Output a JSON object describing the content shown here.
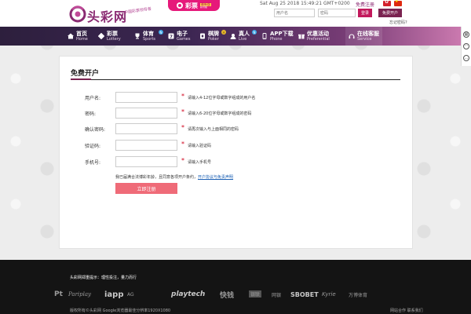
{
  "header": {
    "logo_text": "头彩网",
    "logo_slogan": "中国彩票领导者",
    "promo": {
      "main": "彩票",
      "badge": "最新版",
      "sub": "彩讯版"
    },
    "datetime": "Sat Aug 25 2018 15:49:21 GMT+0200",
    "register_link": "免费注册",
    "username_placeholder": "用户名",
    "password_placeholder": "密码",
    "login_label": "登录",
    "register_label": "免费开户",
    "forgot_label": "忘记密码?"
  },
  "nav": [
    {
      "cn": "首页",
      "en": "Home",
      "icon": "home-icon",
      "badge": ""
    },
    {
      "cn": "彩票",
      "en": "Lottery",
      "icon": "lottery-icon",
      "badge": ""
    },
    {
      "cn": "体育",
      "en": "Sports",
      "icon": "trophy-icon",
      "badge": "N"
    },
    {
      "cn": "电子",
      "en": "Games",
      "icon": "slot-icon",
      "badge": ""
    },
    {
      "cn": "棋牌",
      "en": "Poker",
      "icon": "poker-icon",
      "badge": "H"
    },
    {
      "cn": "真人",
      "en": "Live",
      "icon": "live-icon",
      "badge": "N"
    },
    {
      "cn": "APP下载",
      "en": "Phone",
      "icon": "phone-icon",
      "badge": ""
    },
    {
      "cn": "优惠活动",
      "en": "Preferential",
      "icon": "gift-icon",
      "badge": ""
    },
    {
      "cn": "在线客服",
      "en": "Service",
      "icon": "service-icon",
      "badge": ""
    }
  ],
  "rail": {
    "icons": [
      "qr-code-icon",
      "headset-icon",
      "chat-icon"
    ]
  },
  "panel": {
    "title": "免费开户",
    "fields": [
      {
        "label": "用户名:",
        "hint": "请输入4-12位字母或数字组成的用户名"
      },
      {
        "label": "密码:",
        "hint": "请输入6-20位字母或数字组成的密码"
      },
      {
        "label": "确认密码:",
        "hint": "请再次输入与上面相同的密码"
      },
      {
        "label": "验证码:",
        "hint": "请输入验证码"
      },
      {
        "label": "手机号:",
        "hint": "请输入手机号"
      }
    ],
    "agree_text": "我已届满合法博彩年龄，且同意各项开户条约，",
    "agree_link": "开户协议与免责声明",
    "submit_label": "立即注册"
  },
  "footer": {
    "notice": "头彩网郑重提示：理性投注，量力而行",
    "partners": [
      "Pt",
      "Pariplay",
      "iapp",
      "AG",
      "playtech",
      "快钱",
      "银联",
      "网银",
      "SBOBET",
      "Kyrie",
      "万博体育"
    ],
    "copyright": "版权所有©头彩网 Google浏览器最佳分辨率1920X1080",
    "right": "网站合作 联系我们"
  },
  "colors": {
    "brand": "#8a2a72",
    "promo": "#e6197a",
    "nav_start": "#2d1f3d",
    "nav_end": "#d27fb4",
    "submit": "#ef6b78",
    "required": "#d0021b",
    "footer_bg": "#141414"
  }
}
